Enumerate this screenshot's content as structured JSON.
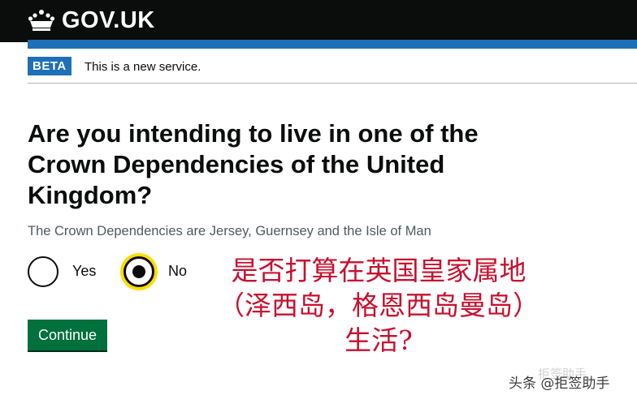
{
  "header": {
    "logo_text": "GOV.UK",
    "logo_icon": "crown-icon",
    "background_color": "#0b0c0c",
    "accent_color": "#1d70b8"
  },
  "phase_banner": {
    "tag": "BETA",
    "text": "This is a new service."
  },
  "question": {
    "heading": "Are you intending to live in one of the Crown Dependencies of the United Kingdom?",
    "hint": "The Crown Dependencies are Jersey, Guernsey and the Isle of Man"
  },
  "options": [
    {
      "label": "Yes",
      "selected": false
    },
    {
      "label": "No",
      "selected": true
    }
  ],
  "continue_button": {
    "label": "Continue",
    "color": "#00703c"
  },
  "annotation": {
    "text": "是否打算在英国皇家属地（泽西岛，格恩西岛曼岛）生活?",
    "color": "#c8102e"
  },
  "watermark": {
    "text": "头条 @拒签助手",
    "ghost_text": "拒签助手"
  }
}
